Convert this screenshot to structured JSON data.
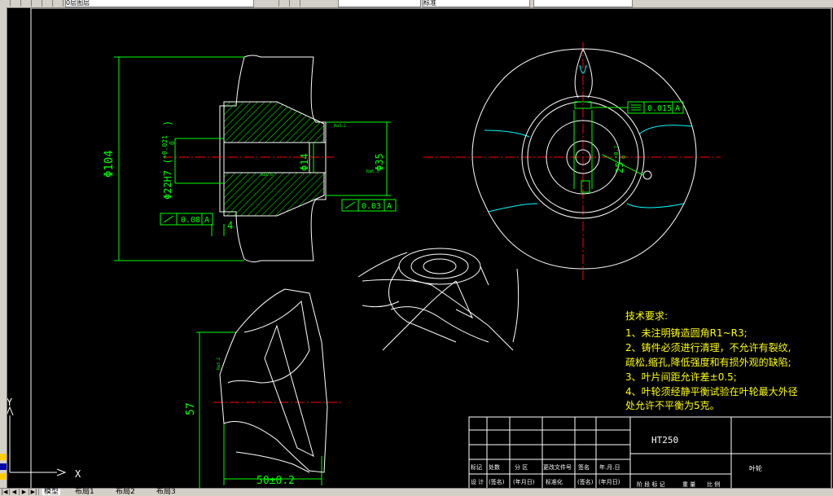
{
  "toolbar": {
    "layer_name": "0层图层",
    "linetype_name": "标准",
    "color_swatch": "#ffff00"
  },
  "tabs": [
    {
      "label": "模型",
      "active": true
    },
    {
      "label": "布局1",
      "active": false
    },
    {
      "label": "布局2",
      "active": false
    },
    {
      "label": "布局3",
      "active": false
    }
  ],
  "ucs": {
    "x_label": "X",
    "y_label": "Y"
  },
  "section_view": {
    "dim_overall_dia": "Φ104",
    "dim_bore": "Φ22H7 (",
    "dim_bore_tol_upper": "+0.021",
    "dim_bore_tol_lower": "0",
    "dim_bore_close": ")",
    "dim_hub": "Φ14",
    "dim_hub_outer": "Φ35",
    "tol_left_value": "0.08",
    "tol_left_datum": "A",
    "tol_right_value": "0.03",
    "tol_right_datum": "A",
    "dim_small": "4",
    "surf_note_1": "Ra1.6",
    "surf_note_2": "Ra3.2",
    "surf_note_3": "Ra6.3",
    "hatch_color": "#00ff00"
  },
  "end_view": {
    "sym_value": "0.015",
    "sym_datum": "A",
    "dim_keyway": "25",
    "dim_keyway_upper": "+0.1",
    "dim_keyway_lower": "0"
  },
  "blade_view": {
    "dim_height": "57",
    "dim_width": "50±0.2",
    "surf_note": "Ra3.2"
  },
  "notes": {
    "title": "技术要求:",
    "lines": [
      "1、未注明铸造圆角R1~R3;",
      "2、铸件必须进行清理，不允许有裂纹,",
      "疏松,缩孔,降低强度和有损外观的缺陷;",
      "3、叶片间距允许差±0.5;",
      "4、叶轮须经静平衡试验在叶轮最大外径",
      "处允许不平衡为5克。"
    ]
  },
  "title_block": {
    "material": "HT250",
    "part_name": "叶轮",
    "row_labels": [
      "标记",
      "处数",
      "分 区",
      "更改文件号",
      "签名",
      "年.月.日"
    ],
    "row2_labels": [
      "设 计",
      "(签名)",
      "(年月日)",
      "标准化",
      "(签名)",
      "(年月日)"
    ],
    "stage_labels": "阶 段 标 记",
    "weight_label": "重 量",
    "scale_label": "比 例"
  }
}
